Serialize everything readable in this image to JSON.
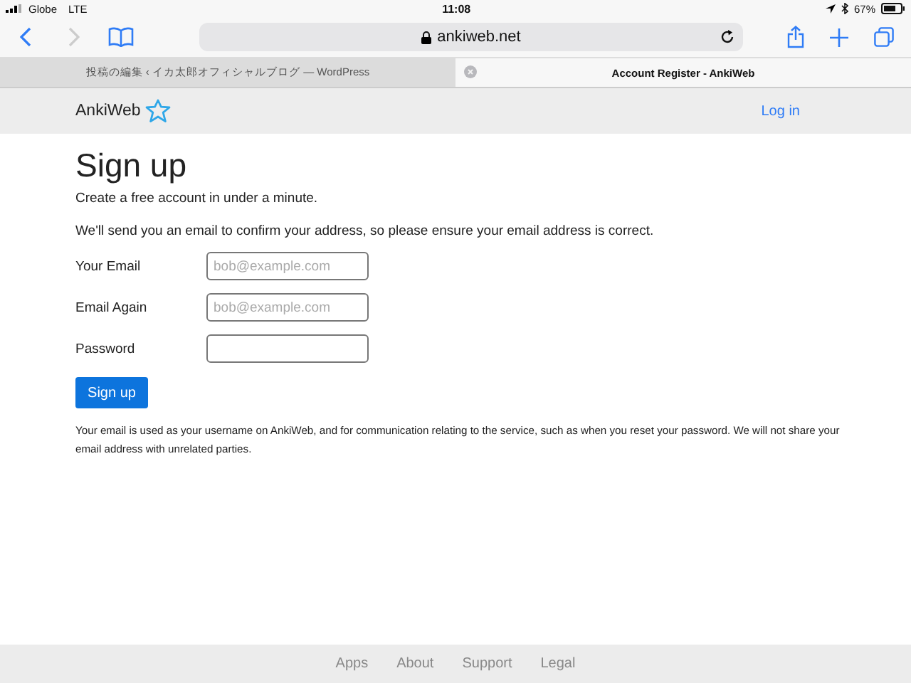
{
  "status_bar": {
    "carrier": "Globe",
    "network": "LTE",
    "time": "11:08",
    "battery": "67%"
  },
  "toolbar": {
    "url": "ankiweb.net"
  },
  "tabs": [
    {
      "title": "投稿の編集 ‹ イカ太郎オフィシャルブログ — WordPress",
      "selected": false
    },
    {
      "title": "Account Register - AnkiWeb",
      "selected": true
    }
  ],
  "site_header": {
    "logo": "AnkiWeb",
    "login": "Log in"
  },
  "heading": "Sign up",
  "intro": "Create a free account in under a minute.",
  "notice": "We'll send you an email to confirm your address, so please ensure your email address is correct.",
  "fields": [
    {
      "label": "Your Email",
      "placeholder": "bob@example.com"
    },
    {
      "label": "Email Again",
      "placeholder": "bob@example.com"
    },
    {
      "label": "Password"
    }
  ],
  "submit": "Sign up",
  "footnote": "Your email is used as your username on AnkiWeb, and for communication relating to the service, such as when you reset your password. We will not share your email address with unrelated parties.",
  "footer_links": [
    "Apps",
    "About",
    "Support",
    "Legal"
  ]
}
